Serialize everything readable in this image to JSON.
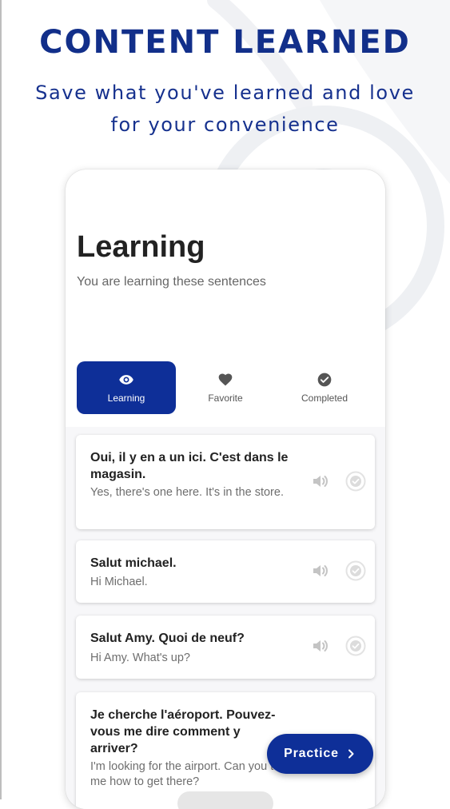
{
  "headline": "CONTENT LEARNED",
  "subline": {
    "line1": "Save what you've learned and love",
    "line2": "for your convenience"
  },
  "screen": {
    "title": "Learning",
    "subtitle": "You are learning these sentences",
    "tabs": [
      {
        "label": "Learning",
        "icon": "eye-icon",
        "active": true
      },
      {
        "label": "Favorite",
        "icon": "heart-icon",
        "active": false
      },
      {
        "label": "Completed",
        "icon": "check-circle-icon",
        "active": false
      }
    ],
    "sentences": [
      {
        "french": "Oui, il y en a un ici. C'est dans le magasin.",
        "english": "Yes, there's one here. It's in the store."
      },
      {
        "french": "Salut michael.",
        "english": "Hi Michael."
      },
      {
        "french": "Salut Amy. Quoi de neuf?",
        "english": "Hi Amy. What's up?"
      },
      {
        "french": "Je cherche l'aéroport. Pouvez-vous me dire comment y arriver?",
        "english": "I'm looking for the airport. Can you tell me how to get there?"
      }
    ],
    "practice_label": "Practice"
  },
  "colors": {
    "brand": "#0e2f98",
    "headline": "#122f8a",
    "text_dark": "#222222",
    "text_muted": "#6e6e6e"
  }
}
